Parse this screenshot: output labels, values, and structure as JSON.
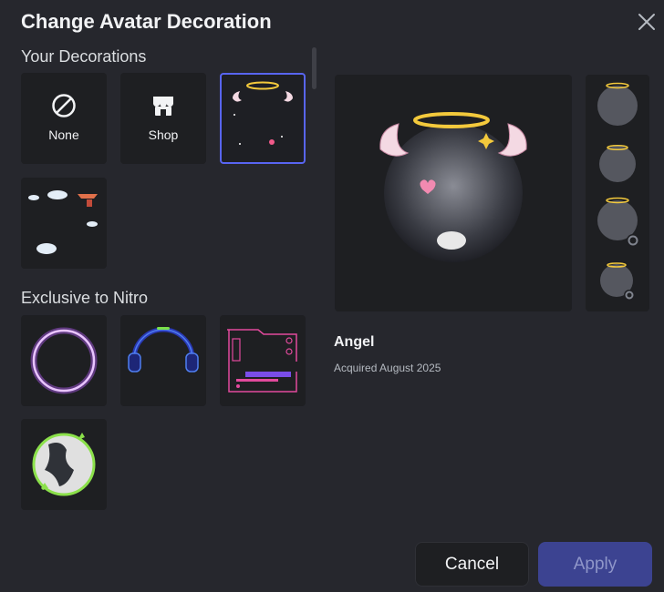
{
  "modal": {
    "title": "Change Avatar Decoration",
    "close_icon": "close-icon"
  },
  "sections": {
    "your_decorations": "Your Decorations",
    "exclusive_nitro": "Exclusive to Nitro"
  },
  "tiles": {
    "none_label": "None",
    "shop_label": "Shop"
  },
  "selected": {
    "name": "Angel",
    "acquired": "Acquired August 2025"
  },
  "buttons": {
    "cancel": "Cancel",
    "apply": "Apply"
  },
  "colors": {
    "accent": "#5865f2",
    "apply_disabled": "#3c4391",
    "background": "#26272d"
  }
}
